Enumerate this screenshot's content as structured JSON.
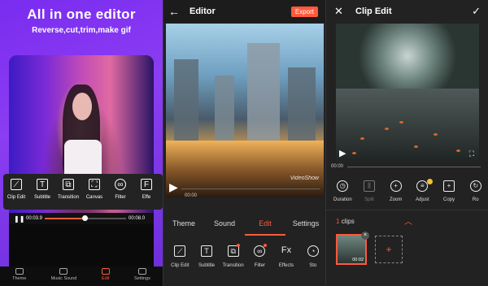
{
  "promo": {
    "title": "All in one editor",
    "subtitle": "Reverse,cut,trim,make gif",
    "player": {
      "current_time": "00:03.9",
      "total_time": "00:08.0",
      "progress": 0.49
    },
    "tools": [
      {
        "label": "Clip Edit",
        "icon": "clip-edit-icon",
        "glyph": "⟋"
      },
      {
        "label": "Subtitle",
        "icon": "subtitle-icon",
        "glyph": "T"
      },
      {
        "label": "Transition",
        "icon": "transition-icon",
        "glyph": "⧉"
      },
      {
        "label": "Canvas",
        "icon": "canvas-icon",
        "glyph": "⛶"
      },
      {
        "label": "Filter",
        "icon": "filter-icon",
        "glyph": "∞"
      },
      {
        "label": "Effe",
        "icon": "effects-icon",
        "glyph": "F"
      }
    ],
    "nav": [
      {
        "label": "Theme"
      },
      {
        "label": "Music Sound"
      },
      {
        "label": "Edit"
      },
      {
        "label": "Settings"
      }
    ],
    "active_nav": "Edit"
  },
  "editor": {
    "title": "Editor",
    "export_label": "Export",
    "watermark": "VideoShow",
    "current_time": "00:00",
    "tabs": [
      "Theme",
      "Sound",
      "Edit",
      "Settings"
    ],
    "active_tab": "Edit",
    "tools": [
      {
        "label": "Clip Edit",
        "icon": "clip-edit-icon",
        "glyph": "⟋"
      },
      {
        "label": "Subtitle",
        "icon": "subtitle-icon",
        "glyph": "T"
      },
      {
        "label": "Transition",
        "icon": "transition-icon",
        "glyph": "⧉",
        "dot": true
      },
      {
        "label": "Filter",
        "icon": "filter-icon",
        "glyph": "∞",
        "dot": true
      },
      {
        "label": "Effects",
        "icon": "effects-icon",
        "glyph": "Fx"
      },
      {
        "label": "Sto",
        "icon": "sticker-icon",
        "glyph": "◔"
      }
    ]
  },
  "clip_edit": {
    "title": "Clip Edit",
    "current_time": "00:00",
    "tools": [
      {
        "label": "Duration",
        "icon": "duration-icon",
        "glyph": "◷"
      },
      {
        "label": "Split",
        "icon": "split-icon",
        "glyph": "⫼",
        "disabled": true
      },
      {
        "label": "Zoom",
        "icon": "zoom-icon",
        "glyph": "+"
      },
      {
        "label": "Adjust",
        "icon": "adjust-icon",
        "glyph": "≡",
        "premium": true
      },
      {
        "label": "Copy",
        "icon": "copy-icon",
        "glyph": "+"
      },
      {
        "label": "Ro",
        "icon": "rotate-icon",
        "glyph": "↻"
      }
    ],
    "clips_count": "1",
    "clips_label": "clips",
    "clip_duration": "00:02",
    "add_clip_glyph": "+"
  },
  "colors": {
    "accent": "#ff5a3c",
    "promo_bg": "#7a2cf0",
    "panel_bg": "#222222"
  }
}
